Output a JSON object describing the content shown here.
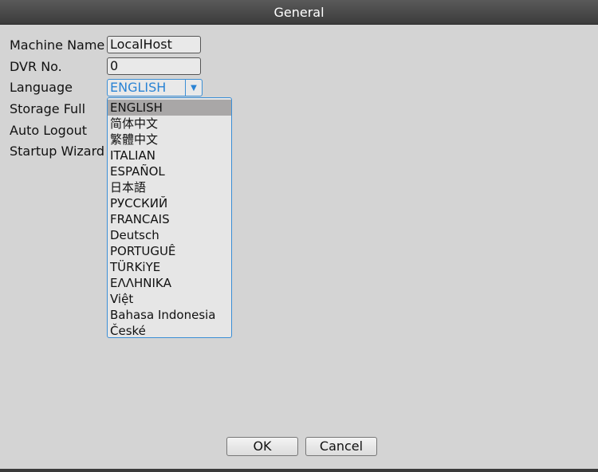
{
  "window": {
    "title": "General"
  },
  "form": {
    "labels": {
      "machine_name": "Machine Name",
      "dvr_no": "DVR No.",
      "language": "Language",
      "storage_full": "Storage Full",
      "auto_logout": "Auto Logout",
      "startup_wizard": "Startup Wizard"
    },
    "machine_name_value": "LocalHost",
    "dvr_no_value": "0",
    "language_value": "ENGLISH"
  },
  "language_options": [
    "ENGLISH",
    "简体中文",
    "繁體中文",
    "ITALIAN",
    "ESPAÑOL",
    "日本語",
    "РУССКИЙ",
    "FRANCAIS",
    "Deutsch",
    "PORTUGUÊ",
    "TÜRKiYE",
    "ΕΛΛΗΝΙΚΑ",
    "Việt",
    "Bahasa Indonesia",
    "České"
  ],
  "selected_language_index": 0,
  "buttons": {
    "ok": "OK",
    "cancel": "Cancel"
  },
  "colors": {
    "accent": "#2a83d4",
    "titlebar": "#4a4a4a",
    "panel": "#d4d4d4",
    "highlight": "#a9a7a7"
  },
  "icons": {
    "dropdown_arrow": "caret-down-icon"
  }
}
